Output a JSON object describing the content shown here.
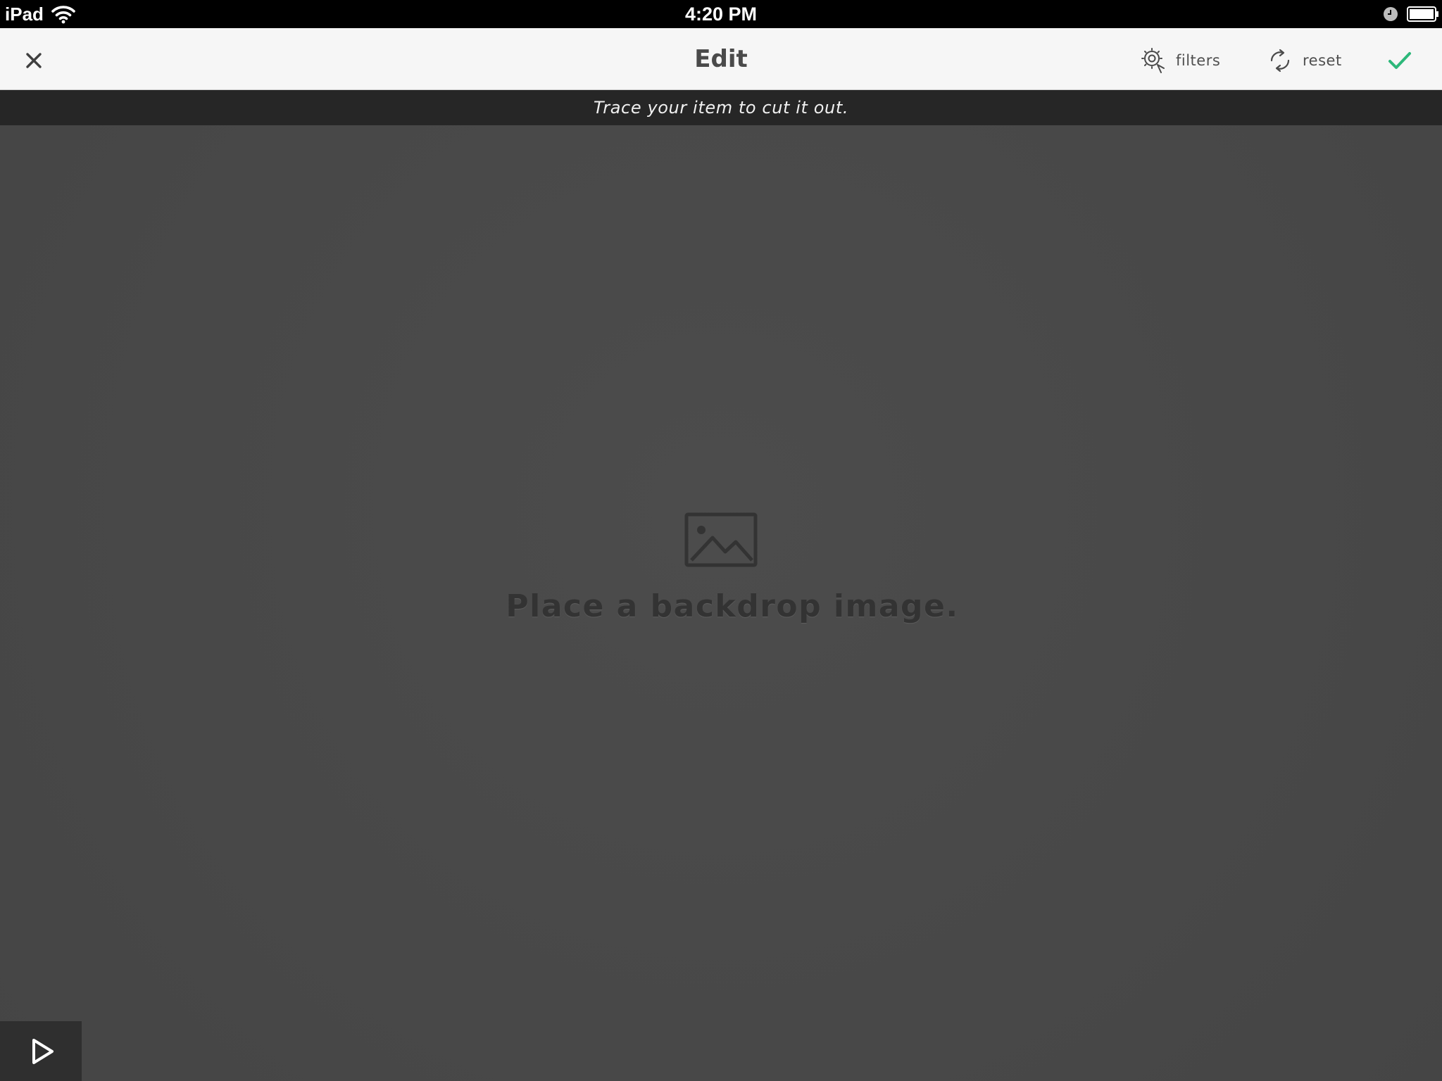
{
  "status_bar": {
    "device": "iPad",
    "time": "4:20 PM",
    "icons": [
      "wifi-icon",
      "clock-icon",
      "battery-icon"
    ]
  },
  "nav_bar": {
    "title": "Edit",
    "close_icon": "close-icon",
    "filters": {
      "label": "filters",
      "icon": "filters-icon"
    },
    "reset": {
      "label": "reset",
      "icon": "reset-icon"
    },
    "confirm_icon": "checkmark-icon"
  },
  "banner": {
    "text": "Trace your item to cut it out."
  },
  "canvas": {
    "placeholder_icon": "image-placeholder-icon",
    "placeholder_text": "Place a backdrop image."
  },
  "play_button": {
    "icon": "play-icon"
  },
  "colors": {
    "accent": "#2db87a",
    "status_bar_bg": "#000000",
    "nav_bg": "#f6f6f6",
    "banner_bg": "#262626",
    "canvas_bg": "#4a4a4a"
  }
}
